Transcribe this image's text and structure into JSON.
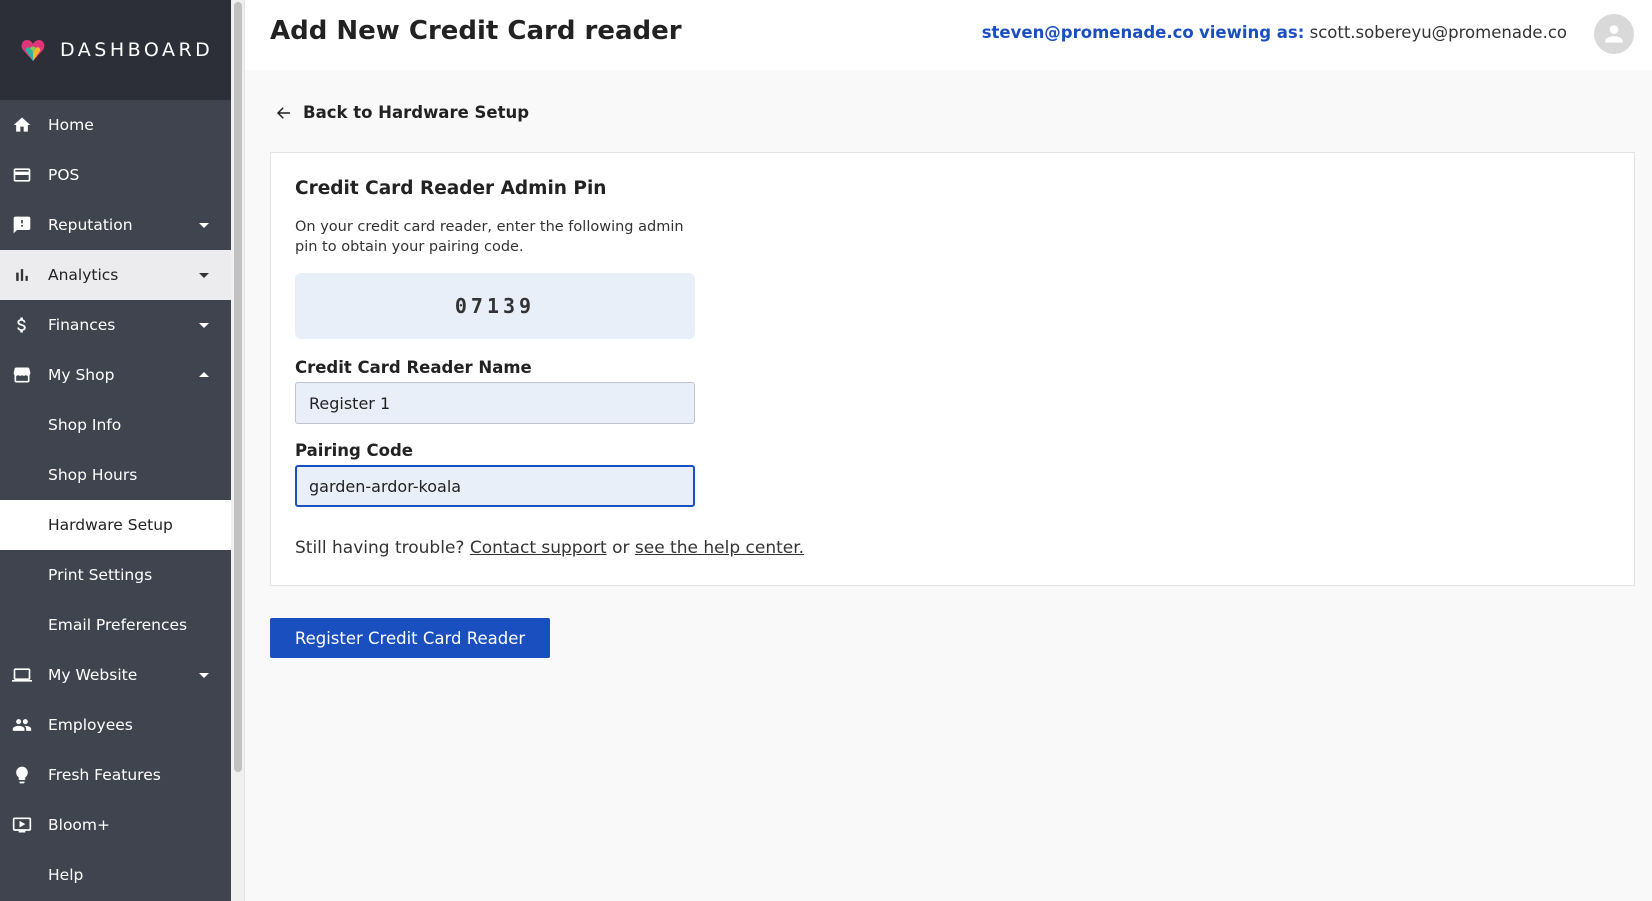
{
  "app": {
    "logo_text": "DASHBOARD"
  },
  "header": {
    "title": "Add New Credit Card reader",
    "current_user": "steven@promenade.co",
    "viewing_as_label": "viewing as:",
    "viewing_as_user": "scott.sobereyu@promenade.co"
  },
  "sidebar": {
    "items": [
      {
        "label": "Home",
        "icon": "home-icon"
      },
      {
        "label": "POS",
        "icon": "pos-card-icon"
      },
      {
        "label": "Reputation",
        "icon": "review-icon",
        "caret": "down"
      },
      {
        "label": "Analytics",
        "icon": "bar-chart-icon",
        "caret": "down"
      },
      {
        "label": "Finances",
        "icon": "dollar-icon",
        "caret": "down"
      },
      {
        "label": "My Shop",
        "icon": "storefront-icon",
        "caret": "up"
      },
      {
        "label": "My Website",
        "icon": "laptop-icon",
        "caret": "down"
      },
      {
        "label": "Employees",
        "icon": "people-icon"
      },
      {
        "label": "Fresh Features",
        "icon": "lightbulb-icon"
      },
      {
        "label": "Bloom+",
        "icon": "video-icon"
      },
      {
        "label": "Help",
        "icon": ""
      }
    ],
    "my_shop_sub": [
      {
        "label": "Shop Info"
      },
      {
        "label": "Shop Hours"
      },
      {
        "label": "Hardware Setup"
      },
      {
        "label": "Print Settings"
      },
      {
        "label": "Email Preferences"
      }
    ]
  },
  "back_link": {
    "label": "Back to Hardware Setup"
  },
  "card": {
    "title": "Credit Card Reader Admin Pin",
    "description": "On your credit card reader, enter the following admin pin to obtain your pairing code.",
    "admin_pin": "07139",
    "reader_name_label": "Credit Card Reader Name",
    "reader_name_value": "Register 1",
    "pairing_code_label": "Pairing Code",
    "pairing_code_value": "garden-ardor-koala",
    "help_prefix": "Still having trouble?",
    "help_contact": "Contact support",
    "help_or": "or",
    "help_center": "see the help center."
  },
  "actions": {
    "register_label": "Register Credit Card Reader"
  },
  "colors": {
    "accent": "#1a4fc0",
    "sidebar_bg": "#40444f",
    "sidebar_header": "#2d2f38",
    "pin_bg": "#e9eff9"
  }
}
